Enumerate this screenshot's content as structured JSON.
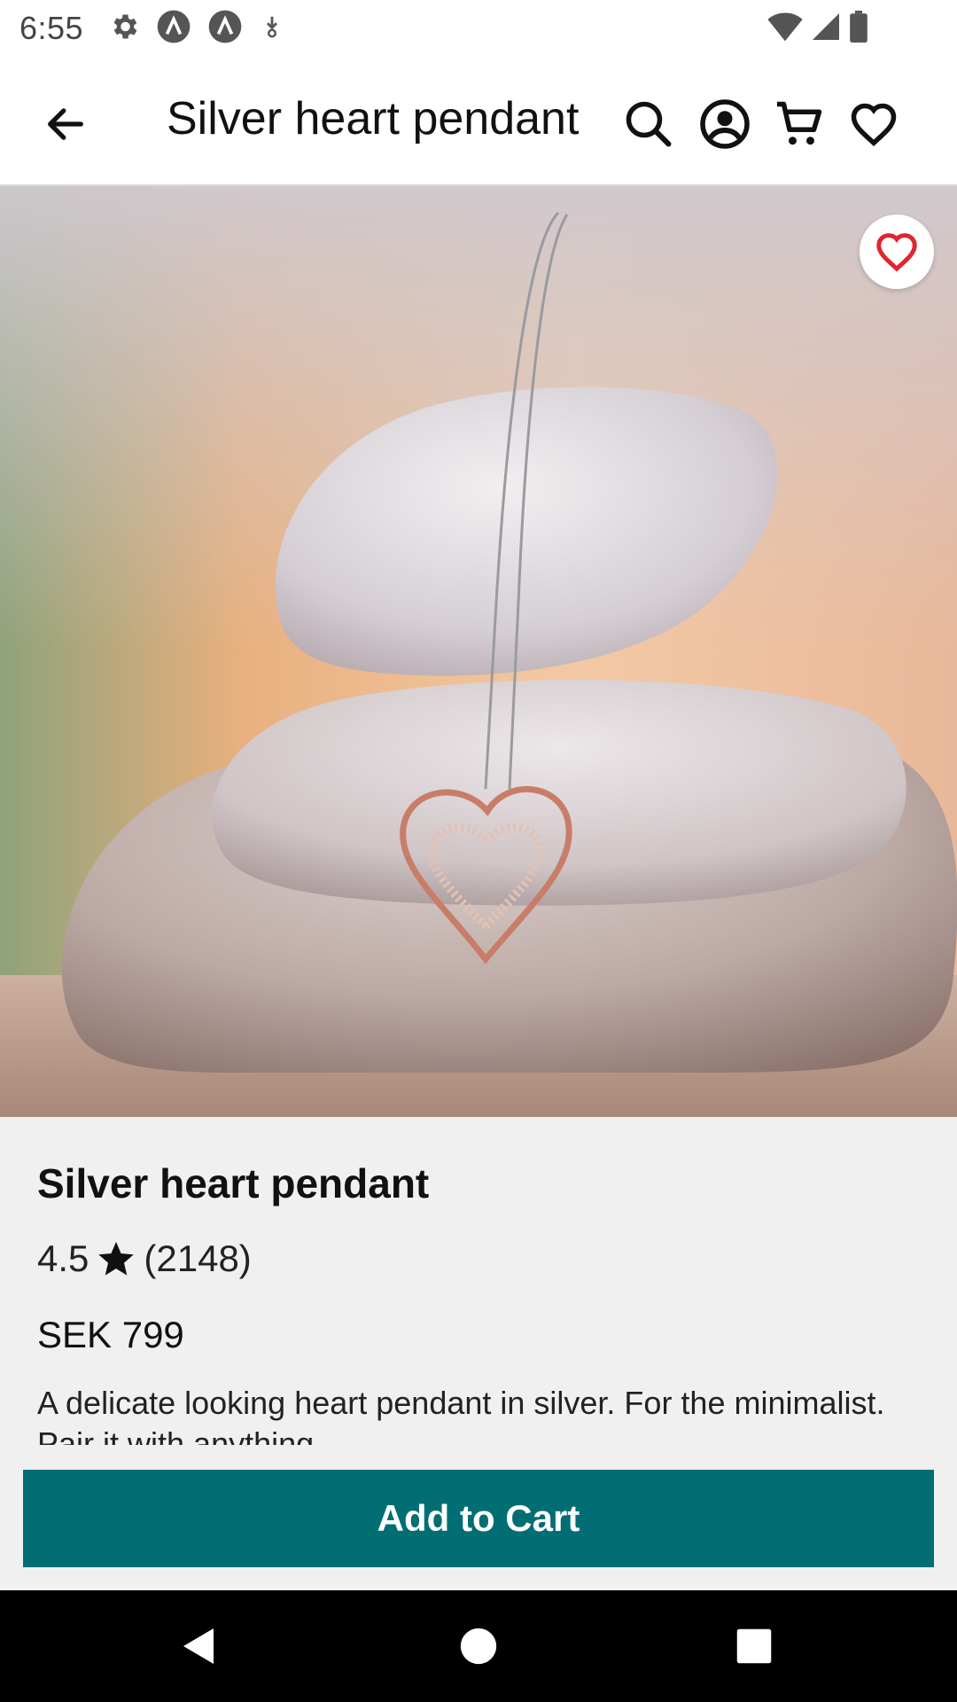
{
  "status_bar": {
    "time": "6:55",
    "left_icons": [
      "gear-icon",
      "app-a-icon",
      "app-a-icon",
      "download-icon"
    ],
    "right_icons": [
      "wifi-icon",
      "signal-icon",
      "battery-icon"
    ]
  },
  "app_bar": {
    "title": "Silver heart pendant",
    "icons": [
      "back-arrow-icon",
      "search-icon",
      "account-icon",
      "cart-icon",
      "heart-outline-icon"
    ]
  },
  "product": {
    "name": "Silver heart pendant",
    "rating": "4.5",
    "review_count": "(2148)",
    "price": "SEK 799",
    "description": "A delicate looking heart pendant in silver. For the minimalist. Pair it with anything."
  },
  "actions": {
    "add_to_cart": "Add to Cart"
  },
  "colors": {
    "accent": "#006e73",
    "favorite": "#e0252f",
    "background": "#f1f0f0"
  }
}
